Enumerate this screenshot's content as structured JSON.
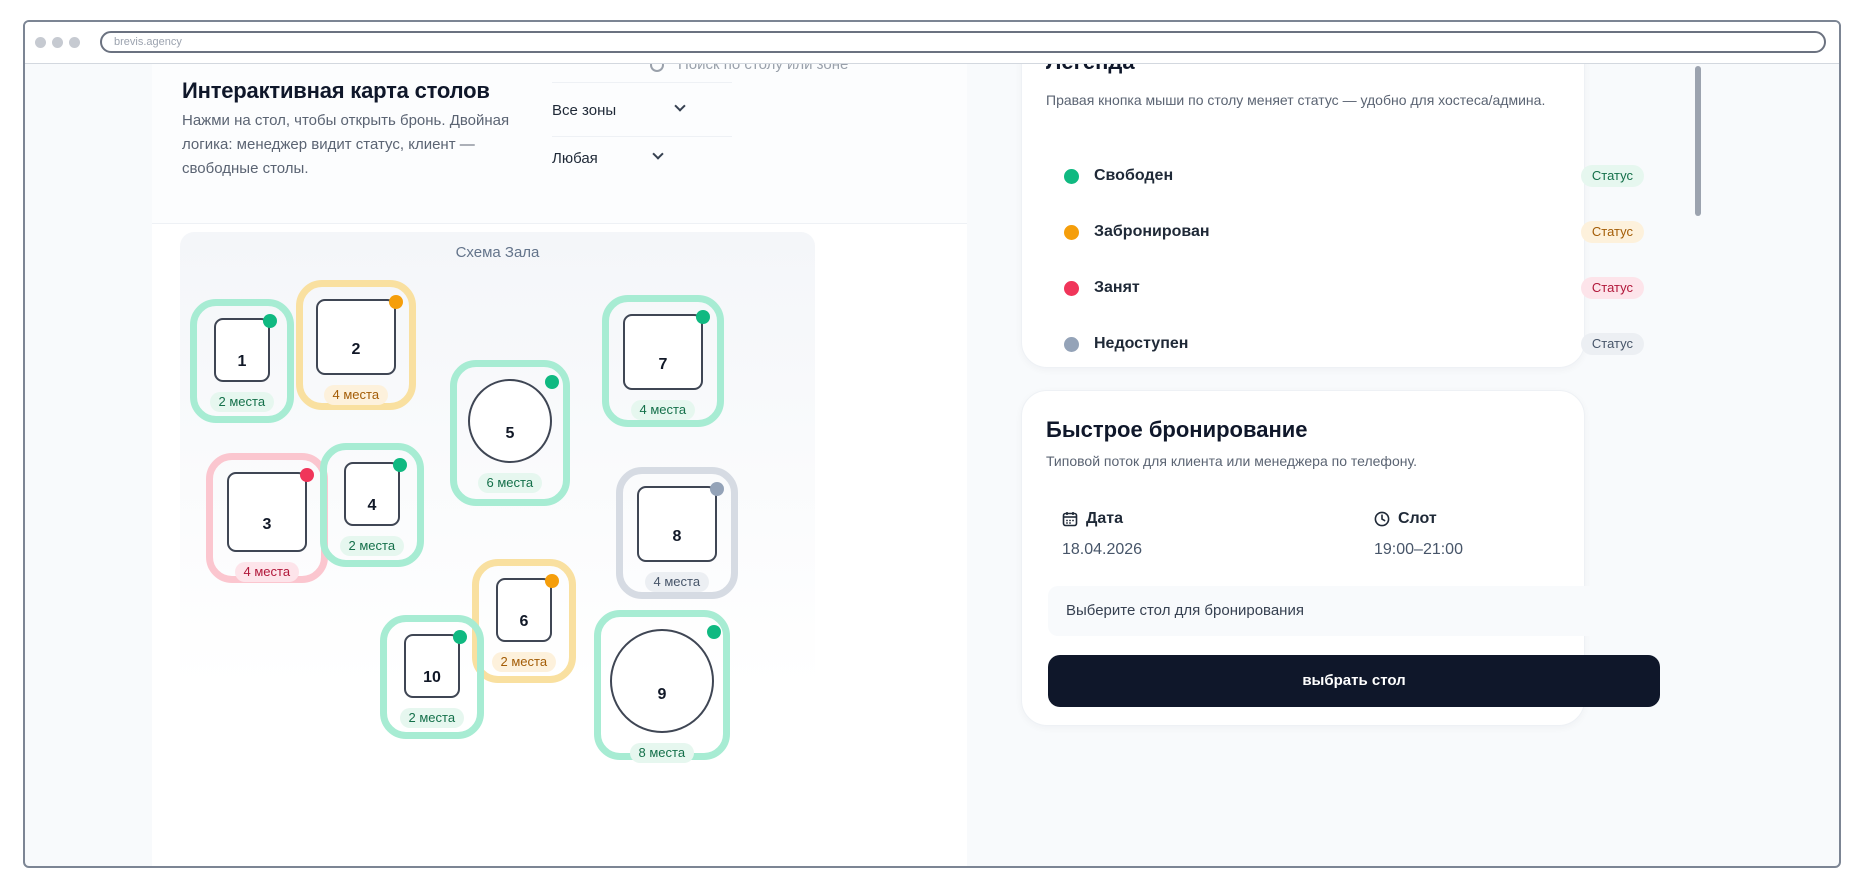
{
  "browser": {
    "url": "brevis.agency"
  },
  "map_panel": {
    "title": "Интерактивная карта столов",
    "subtitle": "Нажми на стол, чтобы открыть бронь. Двойная логика: менеджер видит статус, клиент — свободные столы.",
    "search_placeholder": "Поиск по столу или зоне",
    "zone_select": "Все зоны",
    "capacity_select": "Любая",
    "hall_title": "Схема Зала",
    "tables": [
      {
        "number": "1",
        "seats": "2 места",
        "status": "free"
      },
      {
        "number": "2",
        "seats": "4 места",
        "status": "booked"
      },
      {
        "number": "3",
        "seats": "4 места",
        "status": "busy"
      },
      {
        "number": "4",
        "seats": "2 места",
        "status": "free"
      },
      {
        "number": "5",
        "seats": "6 места",
        "status": "free"
      },
      {
        "number": "6",
        "seats": "2 места",
        "status": "booked"
      },
      {
        "number": "7",
        "seats": "4 места",
        "status": "free"
      },
      {
        "number": "8",
        "seats": "4 места",
        "status": "na"
      },
      {
        "number": "9",
        "seats": "8 места",
        "status": "free"
      },
      {
        "number": "10",
        "seats": "2 места",
        "status": "free"
      }
    ]
  },
  "legend": {
    "title": "Легенда",
    "subtitle": "Правая кнопка мыши по столу меняет статус — удобно для хостеса/админа.",
    "items": [
      {
        "name": "Свободен",
        "badge": "Статус",
        "color": "#10b981"
      },
      {
        "name": "Забронирован",
        "badge": "Статус",
        "color": "#f59e0b"
      },
      {
        "name": "Занят",
        "badge": "Статус",
        "color": "#f0355a"
      },
      {
        "name": "Недоступен",
        "badge": "Статус",
        "color": "#94a3b8"
      }
    ]
  },
  "quick_booking": {
    "title": "Быстрое бронирование",
    "subtitle": "Типовой поток для клиента или менеджера по телефону.",
    "date_label": "Дата",
    "date_value": "18.04.2026",
    "slot_label": "Слот",
    "slot_value": "19:00–21:00",
    "hint": "Выберите стол для бронирования",
    "cta": "выбрать стол"
  }
}
